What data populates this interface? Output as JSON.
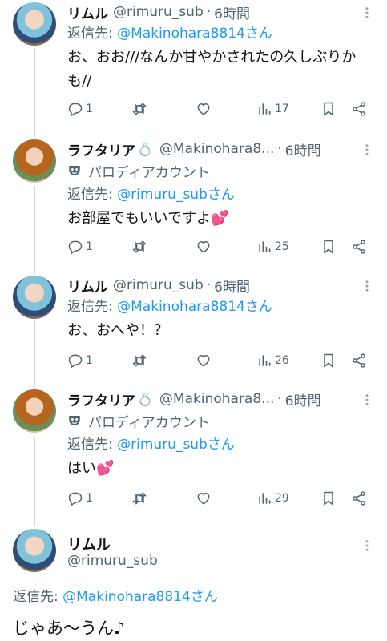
{
  "tweets": [
    {
      "name": "リムル",
      "handle": "@rimuru_sub",
      "time": "6時間",
      "reply_label": "返信先: ",
      "reply_mention": "@Makinohara8814さん",
      "text": "お、おお///なんか甘やかされたの久しぶりかも//",
      "replies": "1",
      "views": "17"
    },
    {
      "name": "ラフタリア",
      "ring": "💍",
      "handle": "@Makinohara8...",
      "time": "6時間",
      "parody": "パロディアカウント",
      "reply_label": "返信先: ",
      "reply_mention": "@rimuru_subさん",
      "text": "お部屋でもいいですよ💕",
      "replies": "1",
      "views": "25"
    },
    {
      "name": "リムル",
      "handle": "@rimuru_sub",
      "time": "6時間",
      "reply_label": "返信先: ",
      "reply_mention": "@Makinohara8814さん",
      "text": "お、おへや！？",
      "replies": "1",
      "views": "26"
    },
    {
      "name": "ラフタリア",
      "ring": "💍",
      "handle": "@Makinohara8...",
      "time": "6時間",
      "parody": "パロディアカウント",
      "reply_label": "返信先: ",
      "reply_mention": "@rimuru_subさん",
      "text": "はい💕",
      "replies": "1",
      "views": "29"
    }
  ],
  "main": {
    "name": "リムル",
    "handle": "@rimuru_sub",
    "reply_label": "返信先: ",
    "reply_mention": "@Makinohara8814さん",
    "text": "じゃあ〜うん♪"
  },
  "separator_dot": "·",
  "icons": {
    "reply": "reply-icon",
    "retweet": "retweet-icon",
    "like": "like-icon",
    "views": "views-icon",
    "bookmark": "bookmark-icon",
    "share": "share-icon",
    "more": "more-icon",
    "parody": "parody-mask-icon"
  },
  "colors": {
    "mention": "#1d9bf0",
    "secondary": "#536471",
    "thread_line": "#cfd9de"
  }
}
